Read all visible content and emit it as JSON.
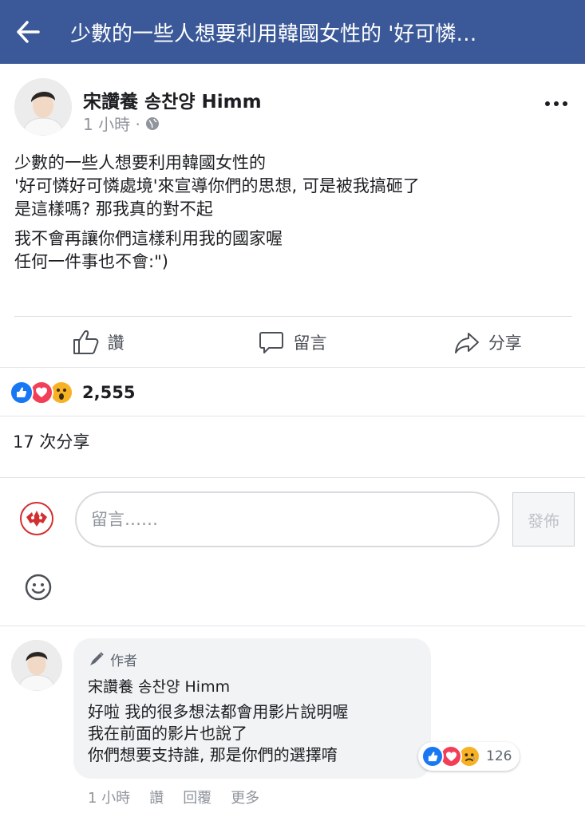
{
  "topbar": {
    "title": "少數的一些人想要利用韓國女性的 '好可憐…",
    "back_icon": "arrow-left-icon",
    "background": "#3b5998"
  },
  "post": {
    "author": "宋讚養 송찬양 Himm",
    "time": "1 小時 ·",
    "privacy_icon": "globe-icon",
    "body": [
      "少數的一些人想要利用韓國女性的",
      "'好可憐好可憐處境'來宣導你們的思想, 可是被我搞砸了",
      "是這樣嗎? 那我真的對不起",
      "我不會再讓你們這樣利用我的國家喔",
      "任何一件事也不會:\")"
    ]
  },
  "actions": {
    "like": "讚",
    "comment": "留言",
    "share": "分享"
  },
  "reactions": {
    "count": "2,555",
    "types": [
      "like",
      "love",
      "wow"
    ],
    "colors": {
      "like": "#1877f2",
      "love": "#f33e58",
      "wow": "#f7b125"
    }
  },
  "shares": "17 次分享",
  "composer": {
    "placeholder": "留言……",
    "post_label": "發佈"
  },
  "comment": {
    "badge": "作者",
    "author": "宋讚養 송찬양 Himm",
    "lines": [
      "好啦 我的很多想法都會用影片說明喔",
      "我在前面的影片也說了",
      "你們想要支持誰, 那是你們的選擇唷"
    ],
    "reaction_count": "126",
    "reaction_types": [
      "like",
      "love",
      "sad"
    ],
    "time": "1 小時",
    "like_label": "讚",
    "reply_label": "回覆",
    "more_label": "更多"
  }
}
